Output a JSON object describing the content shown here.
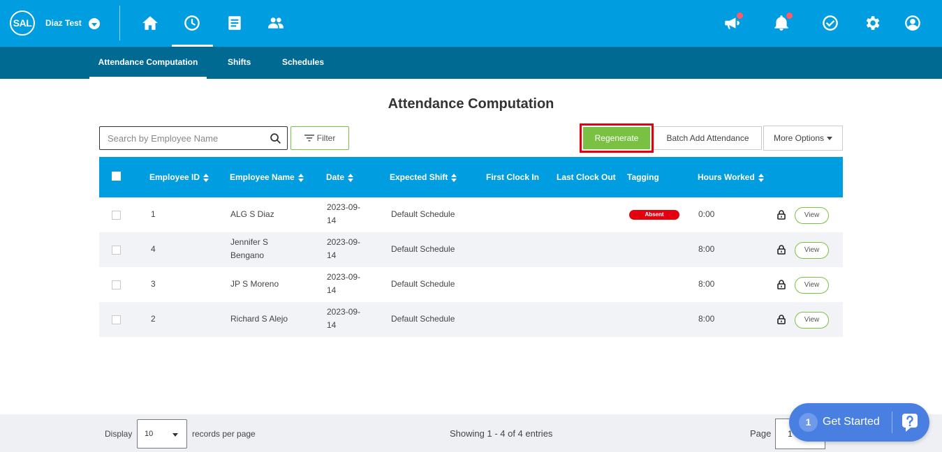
{
  "header": {
    "logo_text": "SAL",
    "company_name": "Diaz Test",
    "nav_icons": [
      "home-icon",
      "clock-icon",
      "document-icon",
      "people-icon"
    ],
    "right_icons": [
      "megaphone-icon",
      "bell-icon",
      "check-circle-icon",
      "gear-icon",
      "user-icon"
    ]
  },
  "subnav": {
    "tabs": [
      {
        "label": "Attendance Computation",
        "active": true
      },
      {
        "label": "Shifts",
        "active": false
      },
      {
        "label": "Schedules",
        "active": false
      }
    ]
  },
  "page": {
    "title": "Attendance Computation"
  },
  "toolbar": {
    "search_placeholder": "Search by Employee Name",
    "filter_label": "Filter",
    "regenerate_label": "Regenerate",
    "batch_label": "Batch Add Attendance",
    "more_label": "More Options"
  },
  "table": {
    "headers": {
      "employee_id": "Employee ID",
      "employee_name": "Employee Name",
      "date": "Date",
      "expected_shift": "Expected Shift",
      "first_clock_in": "First Clock In",
      "last_clock_out": "Last Clock Out",
      "tagging": "Tagging",
      "hours_worked": "Hours Worked"
    },
    "rows": [
      {
        "id": "1",
        "name_line1": "ALG S Diaz",
        "name_line2": "",
        "date_line1": "2023-09-",
        "date_line2": "14",
        "shift": "Default Schedule",
        "tag": "Absent",
        "hours": "0:00",
        "action": "View"
      },
      {
        "id": "4",
        "name_line1": "Jennifer S",
        "name_line2": "Bengano",
        "date_line1": "2023-09-",
        "date_line2": "14",
        "shift": "Default Schedule",
        "tag": "",
        "hours": "8:00",
        "action": "View"
      },
      {
        "id": "3",
        "name_line1": "JP S Moreno",
        "name_line2": "",
        "date_line1": "2023-09-",
        "date_line2": "14",
        "shift": "Default Schedule",
        "tag": "",
        "hours": "8:00",
        "action": "View"
      },
      {
        "id": "2",
        "name_line1": "Richard S Alejo",
        "name_line2": "",
        "date_line1": "2023-09-",
        "date_line2": "14",
        "shift": "Default Schedule",
        "tag": "",
        "hours": "8:00",
        "action": "View"
      }
    ]
  },
  "footer": {
    "display_label": "Display",
    "per_page_value": "10",
    "records_label": "records per page",
    "showing_text": "Showing 1 - 4 of 4 entries",
    "page_label": "Page",
    "page_value": "1"
  },
  "widget": {
    "count": "1",
    "label": "Get Started"
  },
  "colors": {
    "primary": "#009de0",
    "subnav": "#006a93",
    "accent_green": "#7ac143",
    "highlight_red": "#e3000f",
    "widget_blue": "#4a7fe2"
  }
}
